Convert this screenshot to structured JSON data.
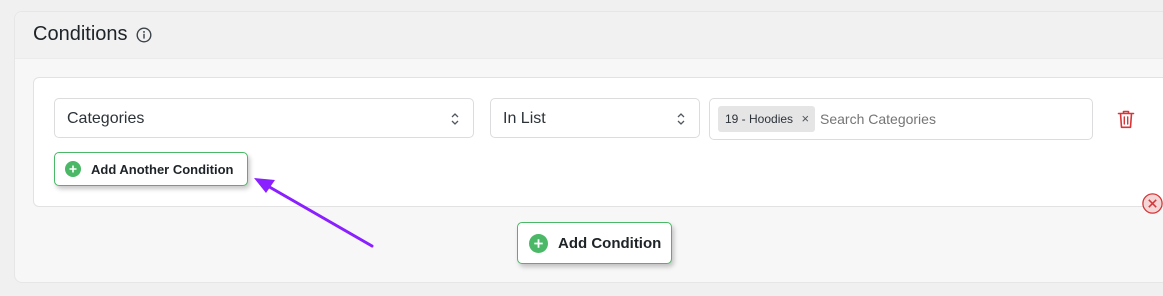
{
  "panel": {
    "title": "Conditions"
  },
  "condition": {
    "field_value": "Categories",
    "operator_value": "In List",
    "selected_tags": [
      {
        "label": "19 - Hoodies",
        "remove_glyph": "×"
      }
    ],
    "search_placeholder": "Search Categories"
  },
  "buttons": {
    "add_another_condition": "Add Another Condition",
    "add_condition": "Add Condition"
  },
  "icons": {
    "info": "info-circle-icon",
    "chevron": "chevron-up-down-icon",
    "trash": "trash-icon",
    "plus": "plus-circle-icon",
    "remove_group": "close-circle-icon"
  },
  "colors": {
    "accent_green": "#4ab866",
    "danger_red": "#d63638",
    "annotation_arrow": "#8a1fff"
  }
}
